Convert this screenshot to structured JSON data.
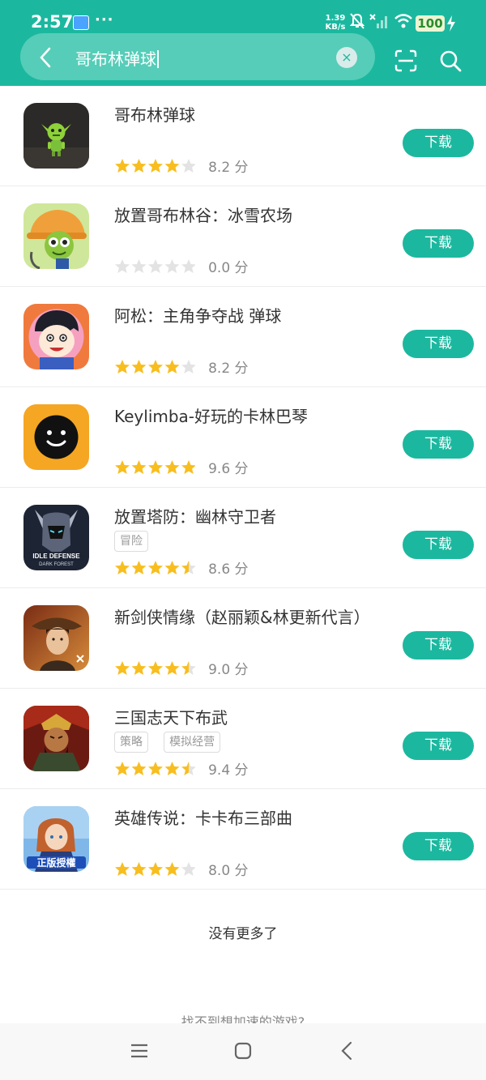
{
  "status_bar": {
    "time": "2:57",
    "speed_value": "1.39",
    "speed_unit": "KB/s",
    "battery": "100",
    "icons": [
      "message-icon",
      "more-dots",
      "muted-bell-icon",
      "no-signal-icon",
      "wifi-icon",
      "charging-icon"
    ]
  },
  "search": {
    "query": "哥布林弹球",
    "clear_icon": "×",
    "icons": [
      "back-arrow-icon",
      "clear-icon",
      "scan-icon",
      "search-icon"
    ]
  },
  "colors": {
    "accent": "#1bb89f",
    "star_filled": "#f8be1f",
    "star_empty": "#e3e3e3"
  },
  "download_label": "下载",
  "results": [
    {
      "name": "哥布林弹球",
      "tags": [],
      "stars": 4,
      "score": "8.2 分"
    },
    {
      "name": "放置哥布林谷：冰雪农场",
      "tags": [],
      "stars": 0,
      "score": "0.0 分"
    },
    {
      "name": "阿松：主角争夺战 弹球",
      "tags": [],
      "stars": 4,
      "score": "8.2 分"
    },
    {
      "name": "Keylimba-好玩的卡林巴琴",
      "tags": [],
      "stars": 5,
      "score": "9.6 分"
    },
    {
      "name": "放置塔防：幽林守卫者",
      "tags": [
        "冒险"
      ],
      "stars": 4.5,
      "score": "8.6 分",
      "icon_text": [
        "IDLE DEFENSE",
        "DARK FOREST"
      ]
    },
    {
      "name": "新剑侠情缘（赵丽颖&林更新代言）",
      "tags": [],
      "stars": 4.5,
      "score": "9.0 分"
    },
    {
      "name": "三国志天下布武",
      "tags": [
        "策略",
        "模拟经营"
      ],
      "stars": 4.5,
      "score": "9.4 分"
    },
    {
      "name": "英雄传说：卡卡布三部曲",
      "tags": [],
      "stars": 4,
      "score": "8.0 分",
      "icon_text": [
        "正版授權"
      ]
    }
  ],
  "footer": {
    "no_more": "没有更多了",
    "cant_find": "找不到想加速的游戏?"
  },
  "nav": [
    "menu-icon",
    "home-icon",
    "back-icon"
  ]
}
